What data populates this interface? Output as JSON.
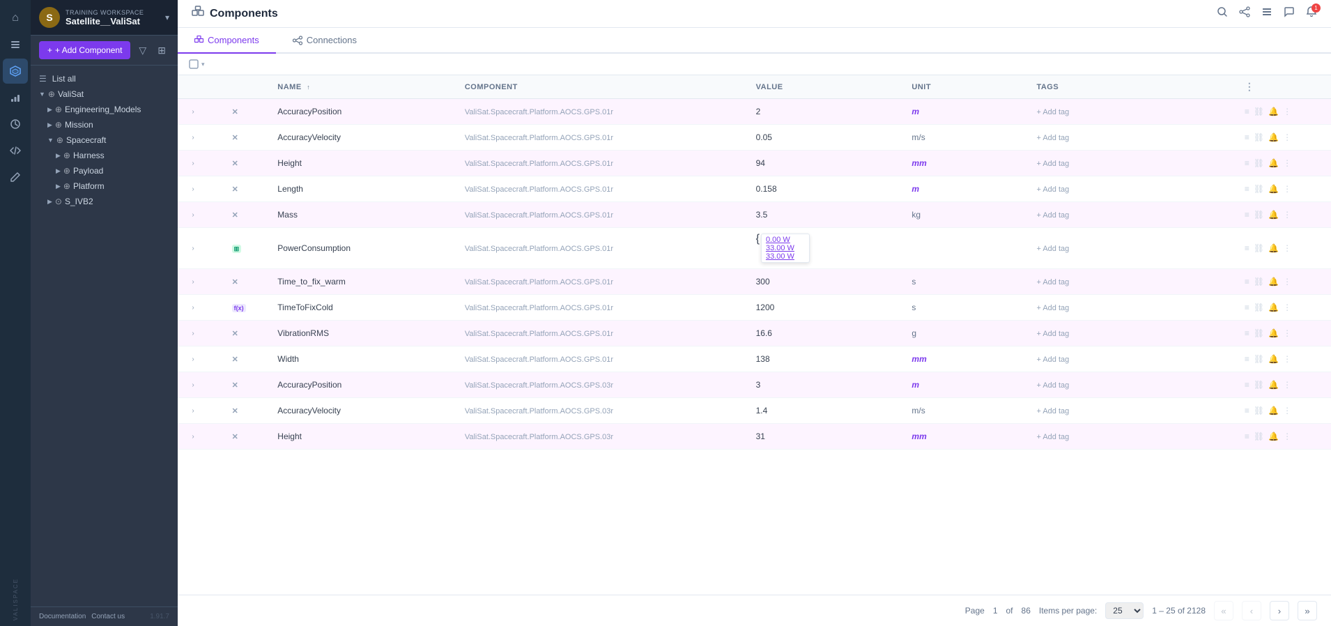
{
  "app": {
    "workspace_label": "TRAINING WORKSPACE",
    "workspace_name": "Satellite__ValiSat",
    "page_title": "Components",
    "version": "1.91.7"
  },
  "nav": {
    "icons": [
      {
        "id": "home",
        "symbol": "⌂",
        "active": false
      },
      {
        "id": "tasks",
        "symbol": "☰",
        "active": false
      },
      {
        "id": "components",
        "symbol": "⬡",
        "active": true
      },
      {
        "id": "chart",
        "symbol": "📊",
        "active": false
      },
      {
        "id": "clock",
        "symbol": "⏱",
        "active": false
      },
      {
        "id": "code",
        "symbol": "</>",
        "active": false
      },
      {
        "id": "edit",
        "symbol": "✏",
        "active": false
      }
    ]
  },
  "tree": {
    "list_all": "List all",
    "items": [
      {
        "label": "ValiSat",
        "indent": 0,
        "icon": "⊕",
        "expand": "▼",
        "id": "valisat"
      },
      {
        "label": "Engineering_Models",
        "indent": 1,
        "icon": "⊕",
        "expand": "▶",
        "id": "eng-models"
      },
      {
        "label": "Mission",
        "indent": 1,
        "icon": "⊕",
        "expand": "▶",
        "id": "mission"
      },
      {
        "label": "Spacecraft",
        "indent": 1,
        "icon": "⊕",
        "expand": "▼",
        "id": "spacecraft"
      },
      {
        "label": "Harness",
        "indent": 2,
        "icon": "⊕",
        "expand": "▶",
        "id": "harness"
      },
      {
        "label": "Payload",
        "indent": 2,
        "icon": "⊕",
        "expand": "▶",
        "id": "payload"
      },
      {
        "label": "Platform",
        "indent": 2,
        "icon": "⊕",
        "expand": "▶",
        "id": "platform"
      },
      {
        "label": "S_IVB2",
        "indent": 1,
        "icon": "⊙",
        "expand": "▶",
        "id": "s-ivb2"
      }
    ]
  },
  "toolbar": {
    "add_component_label": "+ Add Component",
    "filter_icon": "▽",
    "grid_icon": "⊞"
  },
  "tabs": [
    {
      "id": "components",
      "label": "Components",
      "icon": "☰",
      "active": true
    },
    {
      "id": "connections",
      "label": "Connections",
      "icon": "⛓",
      "active": false
    }
  ],
  "table": {
    "columns": [
      {
        "id": "expand",
        "label": ""
      },
      {
        "id": "type",
        "label": ""
      },
      {
        "id": "name",
        "label": "NAME"
      },
      {
        "id": "component",
        "label": "COMPONENT"
      },
      {
        "id": "value",
        "label": "VALUE"
      },
      {
        "id": "unit",
        "label": "UNIT"
      },
      {
        "id": "tags",
        "label": "TAGS"
      },
      {
        "id": "more",
        "label": ""
      }
    ],
    "rows": [
      {
        "id": 1,
        "expand": true,
        "type": "X",
        "type_style": "x",
        "name": "AccuracyPosition",
        "component": "ValiSat.Spacecraft.Platform.AOCS.GPS.01r",
        "value": "2",
        "unit": "m",
        "tags": "+ Add tag",
        "highlighted": true
      },
      {
        "id": 2,
        "expand": true,
        "type": "X",
        "type_style": "x",
        "name": "AccuracyVelocity",
        "component": "ValiSat.Spacecraft.Platform.AOCS.GPS.01r",
        "value": "0.05",
        "unit": "m/s",
        "tags": "+ Add tag",
        "highlighted": false
      },
      {
        "id": 3,
        "expand": true,
        "type": "X",
        "type_style": "x",
        "name": "Height",
        "component": "ValiSat.Spacecraft.Platform.AOCS.GPS.01r",
        "value": "94",
        "unit": "mm",
        "tags": "+ Add tag",
        "highlighted": true
      },
      {
        "id": 4,
        "expand": true,
        "type": "X",
        "type_style": "x",
        "name": "Length",
        "component": "ValiSat.Spacecraft.Platform.AOCS.GPS.01r",
        "value": "0.158",
        "unit": "m",
        "tags": "+ Add tag",
        "highlighted": false
      },
      {
        "id": 5,
        "expand": true,
        "type": "X",
        "type_style": "x",
        "name": "Mass",
        "component": "ValiSat.Spacecraft.Platform.AOCS.GPS.01r",
        "value": "3.5",
        "unit": "kg",
        "tags": "+ Add tag",
        "highlighted": true
      },
      {
        "id": 6,
        "expand": true,
        "type": "TABLE",
        "type_style": "table",
        "name": "PowerConsumption",
        "component": "ValiSat.Spacecraft.Platform.AOCS.GPS.01r",
        "value_popup": true,
        "power_values": [
          "0.00 W",
          "33.00 W",
          "33.00 W"
        ],
        "unit": "",
        "tags": "+ Add tag",
        "highlighted": false
      },
      {
        "id": 7,
        "expand": true,
        "type": "X",
        "type_style": "x",
        "name": "Time_to_fix_warm",
        "component": "ValiSat.Spacecraft.Platform.AOCS.GPS.01r",
        "value": "300",
        "unit": "s",
        "tags": "+ Add tag",
        "highlighted": true
      },
      {
        "id": 8,
        "expand": true,
        "type": "f(x)",
        "type_style": "formula",
        "name": "TimeToFixCold",
        "component": "ValiSat.Spacecraft.Platform.AOCS.GPS.01r",
        "value": "1200",
        "unit": "s",
        "tags": "+ Add tag",
        "highlighted": false
      },
      {
        "id": 9,
        "expand": true,
        "type": "X",
        "type_style": "x",
        "name": "VibrationRMS",
        "component": "ValiSat.Spacecraft.Platform.AOCS.GPS.01r",
        "value": "16.6",
        "unit": "g",
        "tags": "+ Add tag",
        "highlighted": true
      },
      {
        "id": 10,
        "expand": true,
        "type": "X",
        "type_style": "x",
        "name": "Width",
        "component": "ValiSat.Spacecraft.Platform.AOCS.GPS.01r",
        "value": "138",
        "unit": "mm",
        "tags": "+ Add tag",
        "highlighted": false
      },
      {
        "id": 11,
        "expand": true,
        "type": "X",
        "type_style": "x",
        "name": "AccuracyPosition",
        "component": "ValiSat.Spacecraft.Platform.AOCS.GPS.03r",
        "value": "3",
        "unit": "m",
        "tags": "+ Add tag",
        "highlighted": true
      },
      {
        "id": 12,
        "expand": true,
        "type": "X",
        "type_style": "x",
        "name": "AccuracyVelocity",
        "component": "ValiSat.Spacecraft.Platform.AOCS.GPS.03r",
        "value": "1.4",
        "unit": "m/s",
        "tags": "+ Add tag",
        "highlighted": false
      },
      {
        "id": 13,
        "expand": true,
        "type": "X",
        "type_style": "x",
        "name": "Height",
        "component": "ValiSat.Spacecraft.Platform.AOCS.GPS.03r",
        "value": "31",
        "unit": "mm",
        "tags": "+ Add tag",
        "highlighted": true
      }
    ]
  },
  "pagination": {
    "page_label": "Page",
    "current_page": "1",
    "total_pages": "86",
    "of_label": "of",
    "items_per_page_label": "Items per page:",
    "items_per_page": "25",
    "range_label": "1 – 25 of 2128"
  },
  "header_actions": {
    "search_icon": "🔍",
    "share_icon": "⛓",
    "list_icon": "☰",
    "chat_icon": "💬",
    "bell_icon": "🔔",
    "bell_badge": "1"
  },
  "footer": {
    "documentation": "Documentation",
    "contact": "Contact us",
    "brand": "VALISPACE"
  }
}
